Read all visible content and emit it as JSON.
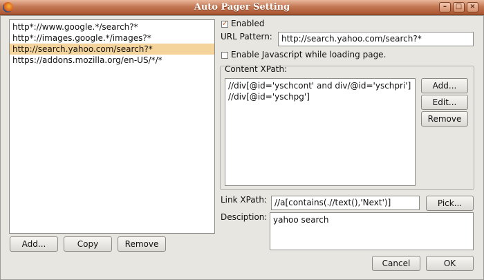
{
  "window": {
    "title": "Auto Pager Setting"
  },
  "site_list": {
    "items": [
      "http*://www.google.*/search?*",
      "http*://images.google.*/images?*",
      "http://search.yahoo.com/search?*",
      "https://addons.mozilla.org/en-US/*/*"
    ],
    "selected_index": 2
  },
  "left_buttons": {
    "add": "Add...",
    "copy": "Copy",
    "remove": "Remove"
  },
  "enabled": {
    "label": "Enabled",
    "checked": true
  },
  "url_pattern": {
    "label": "URL Pattern:",
    "value": "http://search.yahoo.com/search?*"
  },
  "enable_js": {
    "label": "Enable Javascript while loading page.",
    "checked": false
  },
  "content_xpath": {
    "label": "Content XPath:",
    "items": [
      "//div[@id='yschcont' and div/@id='yschpri']",
      "//div[@id='yschpg']"
    ],
    "add": "Add...",
    "edit": "Edit...",
    "remove": "Remove"
  },
  "link_xpath": {
    "label": "Link XPath:",
    "value": "//a[contains(.//text(),'Next')]",
    "pick": "Pick..."
  },
  "description": {
    "label": "Desciption:",
    "value": "yahoo search"
  },
  "footer": {
    "cancel": "Cancel",
    "ok": "OK"
  },
  "colors": {
    "titlebar": "#c47955",
    "selection": "#f5d49b"
  }
}
